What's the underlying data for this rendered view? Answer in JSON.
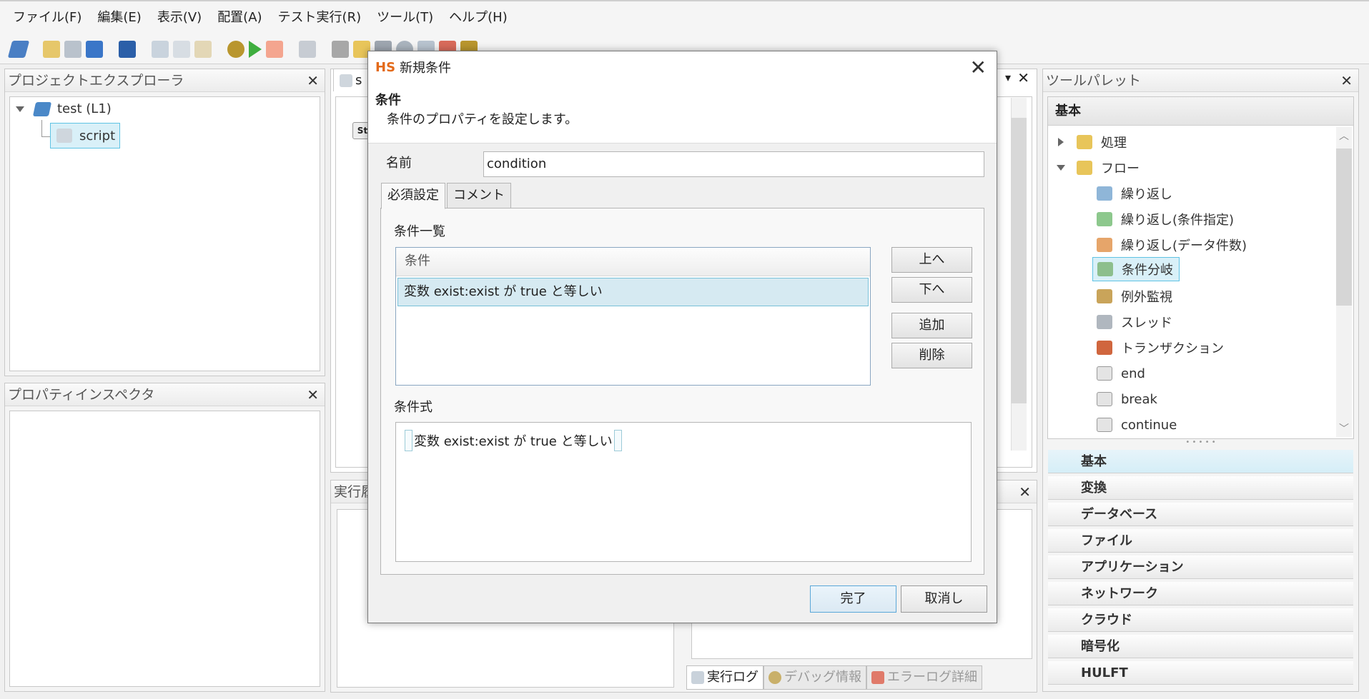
{
  "menu": [
    "ファイル(F)",
    "編集(E)",
    "表示(V)",
    "配置(A)",
    "テスト実行(R)",
    "ツール(T)",
    "ヘルプ(H)"
  ],
  "project_explorer": {
    "title": "プロジェクトエクスプローラ",
    "close": "✕",
    "project": "test (L1)",
    "script": "script"
  },
  "property_inspector": {
    "title": "プロパティインスペクタ",
    "close": "✕"
  },
  "editor": {
    "tab_label": "s",
    "canvas_label": "St"
  },
  "execution_panel": {
    "title": "実行履"
  },
  "dialog": {
    "app_badge": "HS",
    "title": "新規条件",
    "close": "✕",
    "header_title": "条件",
    "header_desc": "条件のプロパティを設定します。",
    "name_label": "名前",
    "name_value": "condition",
    "tabs": [
      "必須設定",
      "コメント"
    ],
    "list_label": "条件一覧",
    "list_header": "条件",
    "list_rows": [
      "変数 exist:exist が true と等しい"
    ],
    "buttons": {
      "up": "上へ",
      "down": "下へ",
      "add": "追加",
      "delete": "削除"
    },
    "expr_label": "条件式",
    "expr_value": "変数 exist:exist が true と等しい",
    "finish": "完了",
    "cancel": "取消し"
  },
  "palette": {
    "title": "ツールパレット",
    "close": "✕",
    "section": "基本",
    "tree": [
      {
        "label": "処理",
        "folder": true,
        "expanded": false
      },
      {
        "label": "フロー",
        "folder": true,
        "expanded": true
      },
      {
        "label": "繰り返し"
      },
      {
        "label": "繰り返し(条件指定)"
      },
      {
        "label": "繰り返し(データ件数)"
      },
      {
        "label": "条件分岐",
        "selected": true
      },
      {
        "label": "例外監視"
      },
      {
        "label": "スレッド"
      },
      {
        "label": "トランザクション"
      },
      {
        "label": "end"
      },
      {
        "label": "break"
      },
      {
        "label": "continue"
      }
    ],
    "categories": [
      "基本",
      "変換",
      "データベース",
      "ファイル",
      "アプリケーション",
      "ネットワーク",
      "クラウド",
      "暗号化",
      "HULFT"
    ]
  },
  "bottom_tabs": [
    "実行ログ",
    "デバッグ情報",
    "エラーログ詳細"
  ],
  "colors": {
    "accent": "#5aa7d8",
    "selection": "#d6eaf2",
    "hs_logo": "#e36a1a"
  }
}
